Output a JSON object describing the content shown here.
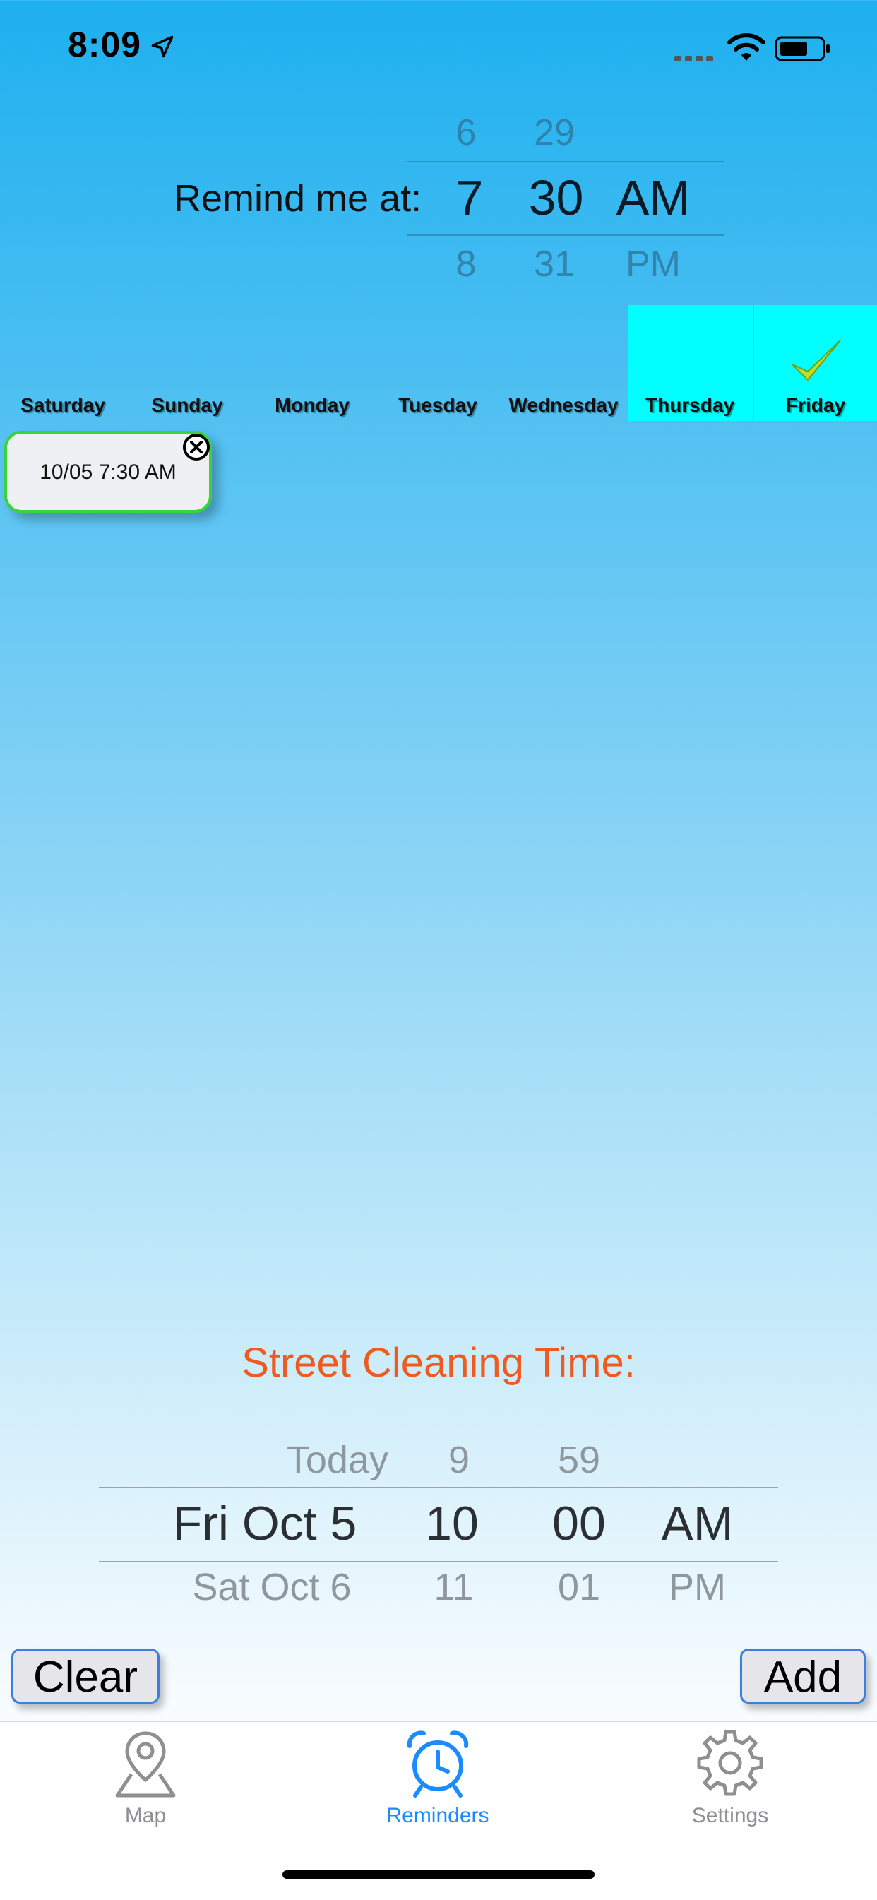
{
  "status_bar": {
    "time": "8:09"
  },
  "remind_picker": {
    "label": "Remind me at:",
    "hour_above": "6",
    "minute_above": "29",
    "hour": "7",
    "minute": "30",
    "ampm": "AM",
    "hour_below": "8",
    "minute_below": "31",
    "ampm_below": "PM"
  },
  "days": [
    "Saturday",
    "Sunday",
    "Monday",
    "Tuesday",
    "Wednesday",
    "Thursday",
    "Friday"
  ],
  "highlighted_days": [
    "Thursday",
    "Friday"
  ],
  "checked_day": "Friday",
  "reminder_chip": {
    "text": "10/05 7:30 AM"
  },
  "street_cleaning": {
    "title": "Street Cleaning Time:",
    "date_above": "Today",
    "hour_above": "9",
    "minute_above": "59",
    "date": "Fri Oct 5",
    "hour": "10",
    "minute": "00",
    "ampm": "AM",
    "date_below": "Sat Oct 6",
    "hour_below": "11",
    "minute_below": "01",
    "ampm_below": "PM"
  },
  "buttons": {
    "clear": "Clear",
    "add": "Add"
  },
  "tabs": [
    {
      "label": "Map",
      "icon": "map-pin-icon",
      "active": false
    },
    {
      "label": "Reminders",
      "icon": "alarm-clock-icon",
      "active": true
    },
    {
      "label": "Settings",
      "icon": "gear-icon",
      "active": false
    }
  ],
  "colors": {
    "accent": "#1a8cff",
    "day_highlight": "#00ffff",
    "street_title": "#ef5a1f",
    "chip_border": "#3ad43a",
    "tab_inactive": "#8e8e93"
  }
}
